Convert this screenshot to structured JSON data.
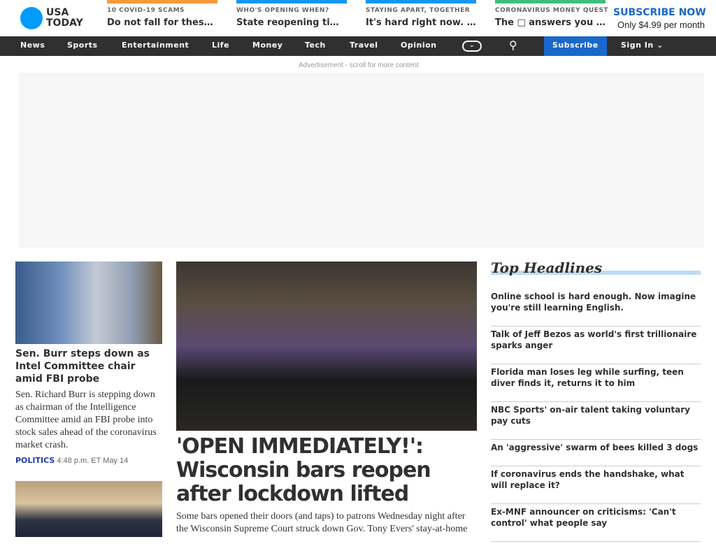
{
  "logo": {
    "line1": "USA",
    "line2": "TODAY"
  },
  "promos": [
    {
      "kicker": "10 COVID-19 SCAMS",
      "title": "Do not fall for these scams",
      "color": "#f59a3c"
    },
    {
      "kicker": "WHO'S OPENING WHEN?",
      "title": "State reopening timeline",
      "color": "#1496f2"
    },
    {
      "kicker": "STAYING APART, TOGETHER",
      "title": "It's hard right now. ☹",
      "color": "#1496f2"
    },
    {
      "kicker": "CORONAVIRUS MONEY QUEST",
      "title": "The □ answers you need",
      "color": "#3ec07a"
    }
  ],
  "subscribe_promo": {
    "title": "SUBSCRIBE NOW",
    "price": "Only $4.99 per month"
  },
  "nav": {
    "items": [
      "News",
      "Sports",
      "Entertainment",
      "Life",
      "Money",
      "Tech",
      "Travel",
      "Opinion"
    ],
    "subscribe": "Subscribe",
    "signin": "Sign In"
  },
  "ad": {
    "label": "Advertisement - scroll for more content"
  },
  "left_story": {
    "headline": "Sen. Burr steps down as Intel Committee chair amid FBI probe",
    "summary": "Sen. Richard Burr is stepping down as chairman of the Intelligence Committee amid an FBI probe into stock sales ahead of the coronavirus market crash.",
    "section": "POLITICS",
    "time": "4:48 p.m. ET May 14"
  },
  "main_story": {
    "headline": "'OPEN IMMEDIATELY!': Wisconsin bars reopen after lockdown lifted",
    "summary": "Some bars opened their doors (and taps) to patrons Wednesday night after the Wisconsin Supreme Court struck down Gov. Tony Evers' stay-at-home"
  },
  "top_headlines": {
    "title": "Top Headlines",
    "items": [
      "Online school is hard enough. Now imagine you're still learning English.",
      "Talk of Jeff Bezos as world's first trillionaire sparks anger",
      "Florida man loses leg while surfing, teen diver finds it, returns it to him",
      "NBC Sports' on-air talent taking voluntary pay cuts",
      "An 'aggressive' swarm of bees killed 3 dogs",
      "If coronavirus ends the handshake, what will replace it?",
      "Ex-MNF announcer on criticisms: 'Can't control' what people say"
    ]
  }
}
